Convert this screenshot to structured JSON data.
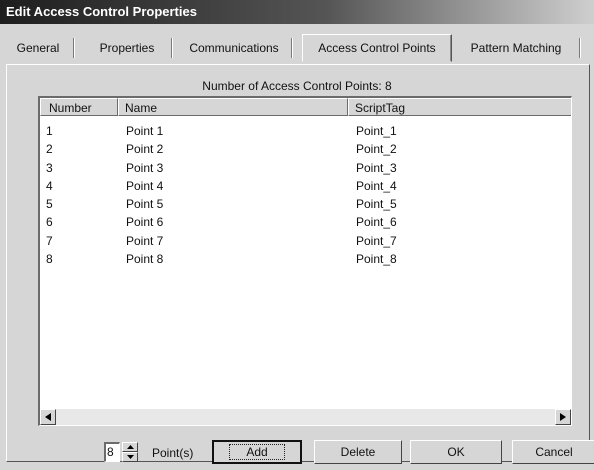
{
  "window": {
    "title": "Edit Access Control Properties"
  },
  "tabs": [
    {
      "label": "General"
    },
    {
      "label": "Properties"
    },
    {
      "label": "Communications"
    },
    {
      "label": "Access Control Points"
    },
    {
      "label": "Pattern Matching"
    }
  ],
  "panel": {
    "count_label": "Number of Access Control Points: 8",
    "columns": [
      "Number",
      "Name",
      "ScriptTag"
    ],
    "rows": [
      [
        "1",
        "Point 1",
        "Point_1"
      ],
      [
        "2",
        "Point 2",
        "Point_2"
      ],
      [
        "3",
        "Point 3",
        "Point_3"
      ],
      [
        "4",
        "Point 4",
        "Point_4"
      ],
      [
        "5",
        "Point 5",
        "Point_5"
      ],
      [
        "6",
        "Point 6",
        "Point_6"
      ],
      [
        "7",
        "Point 7",
        "Point_7"
      ],
      [
        "8",
        "Point 8",
        "Point_8"
      ]
    ]
  },
  "bottom": {
    "spinner_value": "8",
    "points_label": "Point(s)",
    "add_label": "Add",
    "delete_label": "Delete",
    "ok_label": "OK",
    "cancel_label": "Cancel"
  },
  "icons": {
    "scroll_left": "triangle-left-icon",
    "scroll_right": "triangle-right-icon",
    "spin_up": "triangle-up-icon",
    "spin_down": "triangle-down-icon"
  }
}
